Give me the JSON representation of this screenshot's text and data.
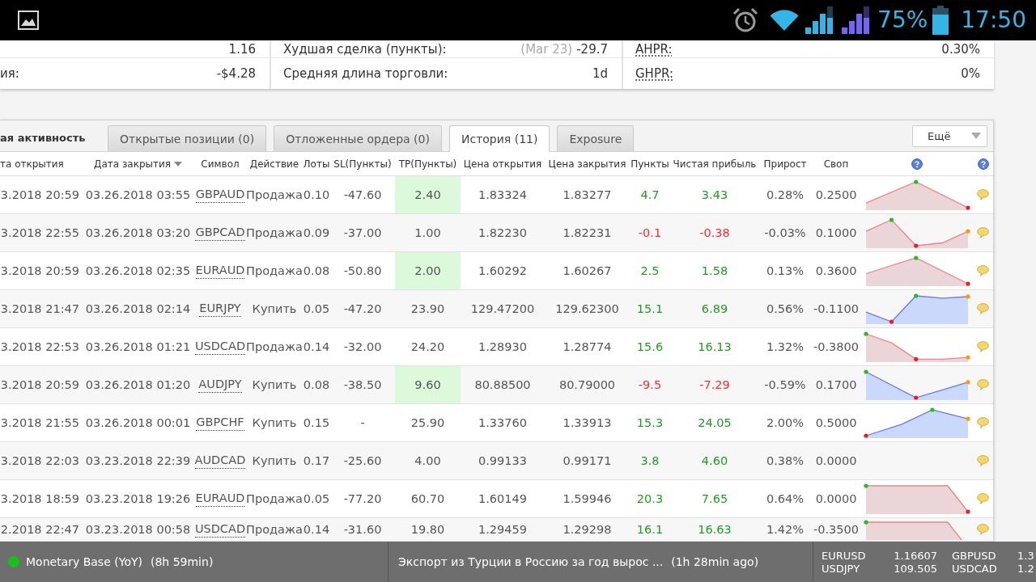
{
  "status_bar": {
    "battery": "75%",
    "time": "17:50"
  },
  "stats": {
    "columns": [
      {
        "rows": [
          {
            "value": "1.16"
          },
          {
            "label": "ия:",
            "has_tooltip": false,
            "value": "-$4.28"
          }
        ]
      },
      {
        "rows": [
          {
            "label": "Худшая сделка (пункты):",
            "has_tooltip": false,
            "note": "(Mar 23)",
            "value": "-29.7"
          },
          {
            "label": "Средняя длина торговли:",
            "has_tooltip": false,
            "value": "1d"
          }
        ]
      },
      {
        "rows": [
          {
            "label": "AHPR:",
            "has_tooltip": true,
            "value": "0.30%"
          },
          {
            "label": "GHPR:",
            "has_tooltip": true,
            "value": "0%"
          }
        ]
      }
    ]
  },
  "activity": {
    "title": "ая активность",
    "tabs": [
      {
        "label": "Открытые позиции (0)",
        "selected": false
      },
      {
        "label": "Отложенные ордера (0)",
        "selected": false
      },
      {
        "label": "История (11)",
        "selected": true
      },
      {
        "label": "Exposure",
        "selected": false
      }
    ],
    "more_menu": {
      "label": "Ещё"
    },
    "table": {
      "columns": [
        {
          "label": "та открытия",
          "sorted": false
        },
        {
          "label": "Дата закрытия",
          "sorted": true
        },
        {
          "label": "Символ",
          "sorted": false
        },
        {
          "label": "Действие",
          "sorted": false
        },
        {
          "label": "Лоты",
          "sorted": false
        },
        {
          "label": "SL(Пункты)",
          "sorted": false
        },
        {
          "label": "TP(Пункты)",
          "sorted": false
        },
        {
          "label": "Цена открытия",
          "sorted": false
        },
        {
          "label": "Цена закрытия",
          "sorted": false
        },
        {
          "label": "Пункты",
          "sorted": false
        },
        {
          "label": "Чистая прибыль",
          "sorted": false
        },
        {
          "label": "Прирост",
          "sorted": false
        },
        {
          "label": "Своп",
          "sorted": false
        }
      ],
      "rows": [
        {
          "open_time": "3.2018 20:59",
          "close_time": "03.26.2018 03:55",
          "symbol": "GBPAUD",
          "action": "Продажа",
          "lots": "0.10",
          "sl": "-47.60",
          "tp": "2.40",
          "tp_reached": true,
          "open_price": "1.83324",
          "close_price": "1.83277",
          "points": "4.7",
          "profit": "3.43",
          "profitable": true,
          "growth": "0.28%",
          "swap": "0.2500"
        },
        {
          "open_time": "3.2018 22:55",
          "close_time": "03.26.2018 03:20",
          "symbol": "GBPCAD",
          "action": "Продажа",
          "lots": "0.09",
          "sl": "-37.00",
          "tp": "1.00",
          "tp_reached": false,
          "open_price": "1.82230",
          "close_price": "1.82231",
          "points": "-0.1",
          "profit": "-0.38",
          "profitable": false,
          "growth": "-0.03%",
          "swap": "0.1000"
        },
        {
          "open_time": "3.2018 20:59",
          "close_time": "03.26.2018 02:35",
          "symbol": "EURAUD",
          "action": "Продажа",
          "lots": "0.08",
          "sl": "-50.80",
          "tp": "2.00",
          "tp_reached": true,
          "open_price": "1.60292",
          "close_price": "1.60267",
          "points": "2.5",
          "profit": "1.58",
          "profitable": true,
          "growth": "0.13%",
          "swap": "0.3600"
        },
        {
          "open_time": "3.2018 21:47",
          "close_time": "03.26.2018 02:14",
          "symbol": "EURJPY",
          "action": "Купить",
          "lots": "0.05",
          "sl": "-47.20",
          "tp": "23.90",
          "tp_reached": false,
          "open_price": "129.47200",
          "close_price": "129.62300",
          "points": "15.1",
          "profit": "6.89",
          "profitable": true,
          "growth": "0.56%",
          "swap": "-0.1100"
        },
        {
          "open_time": "3.2018 22:53",
          "close_time": "03.26.2018 01:21",
          "symbol": "USDCAD",
          "action": "Продажа",
          "lots": "0.14",
          "sl": "-32.00",
          "tp": "24.20",
          "tp_reached": false,
          "open_price": "1.28930",
          "close_price": "1.28774",
          "points": "15.6",
          "profit": "16.13",
          "profitable": true,
          "growth": "1.32%",
          "swap": "-0.3800"
        },
        {
          "open_time": "3.2018 20:59",
          "close_time": "03.26.2018 01:20",
          "symbol": "AUDJPY",
          "action": "Купить",
          "lots": "0.08",
          "sl": "-38.50",
          "tp": "9.60",
          "tp_reached": true,
          "open_price": "80.88500",
          "close_price": "80.79000",
          "points": "-9.5",
          "profit": "-7.29",
          "profitable": false,
          "growth": "-0.59%",
          "swap": "0.1700"
        },
        {
          "open_time": "3.2018 21:55",
          "close_time": "03.26.2018 00:01",
          "symbol": "GBPCHF",
          "action": "Купить",
          "lots": "0.15",
          "sl": "-",
          "tp": "25.90",
          "tp_reached": false,
          "open_price": "1.33760",
          "close_price": "1.33913",
          "points": "15.3",
          "profit": "24.05",
          "profitable": true,
          "growth": "2.00%",
          "swap": "0.5000"
        },
        {
          "open_time": "3.2018 22:03",
          "close_time": "03.23.2018 22:39",
          "symbol": "AUDCAD",
          "action": "Купить",
          "lots": "0.17",
          "sl": "-25.60",
          "tp": "4.00",
          "tp_reached": false,
          "open_price": "0.99133",
          "close_price": "0.99171",
          "points": "3.8",
          "profit": "4.60",
          "profitable": true,
          "growth": "0.38%",
          "swap": "0.0000"
        },
        {
          "open_time": "3.2018 18:59",
          "close_time": "03.23.2018 19:26",
          "symbol": "EURAUD",
          "action": "Продажа",
          "lots": "0.05",
          "sl": "-77.20",
          "tp": "60.70",
          "tp_reached": false,
          "open_price": "1.60149",
          "close_price": "1.59946",
          "points": "20.3",
          "profit": "7.65",
          "profitable": true,
          "growth": "0.64%",
          "swap": "0.0000"
        },
        {
          "open_time": "2.2018 22:47",
          "close_time": "03.23.2018 00:58",
          "symbol": "USDCAD",
          "action": "Продажа",
          "lots": "0.14",
          "sl": "-31.60",
          "tp": "19.80",
          "tp_reached": false,
          "open_price": "1.29459",
          "close_price": "1.29298",
          "points": "16.1",
          "profit": "16.63",
          "profitable": true,
          "growth": "1.42%",
          "swap": "-0.3500"
        }
      ]
    }
  },
  "ticker": {
    "news": [
      {
        "kind": "event",
        "title": "Monetary Base (YoY)",
        "time": "(8h 59min)"
      },
      {
        "kind": "news",
        "title": "Экспорт из Турции в Россию за год вырос ...",
        "time": "(1h 28min ago)"
      }
    ],
    "quotes": [
      {
        "symbol": "EURUSD",
        "price": "1.16607"
      },
      {
        "symbol": "GBPUSD",
        "price": "1.3"
      },
      {
        "symbol": "USDJPY",
        "price": "109.505"
      },
      {
        "symbol": "USDCAD",
        "price": "1.2"
      }
    ]
  }
}
